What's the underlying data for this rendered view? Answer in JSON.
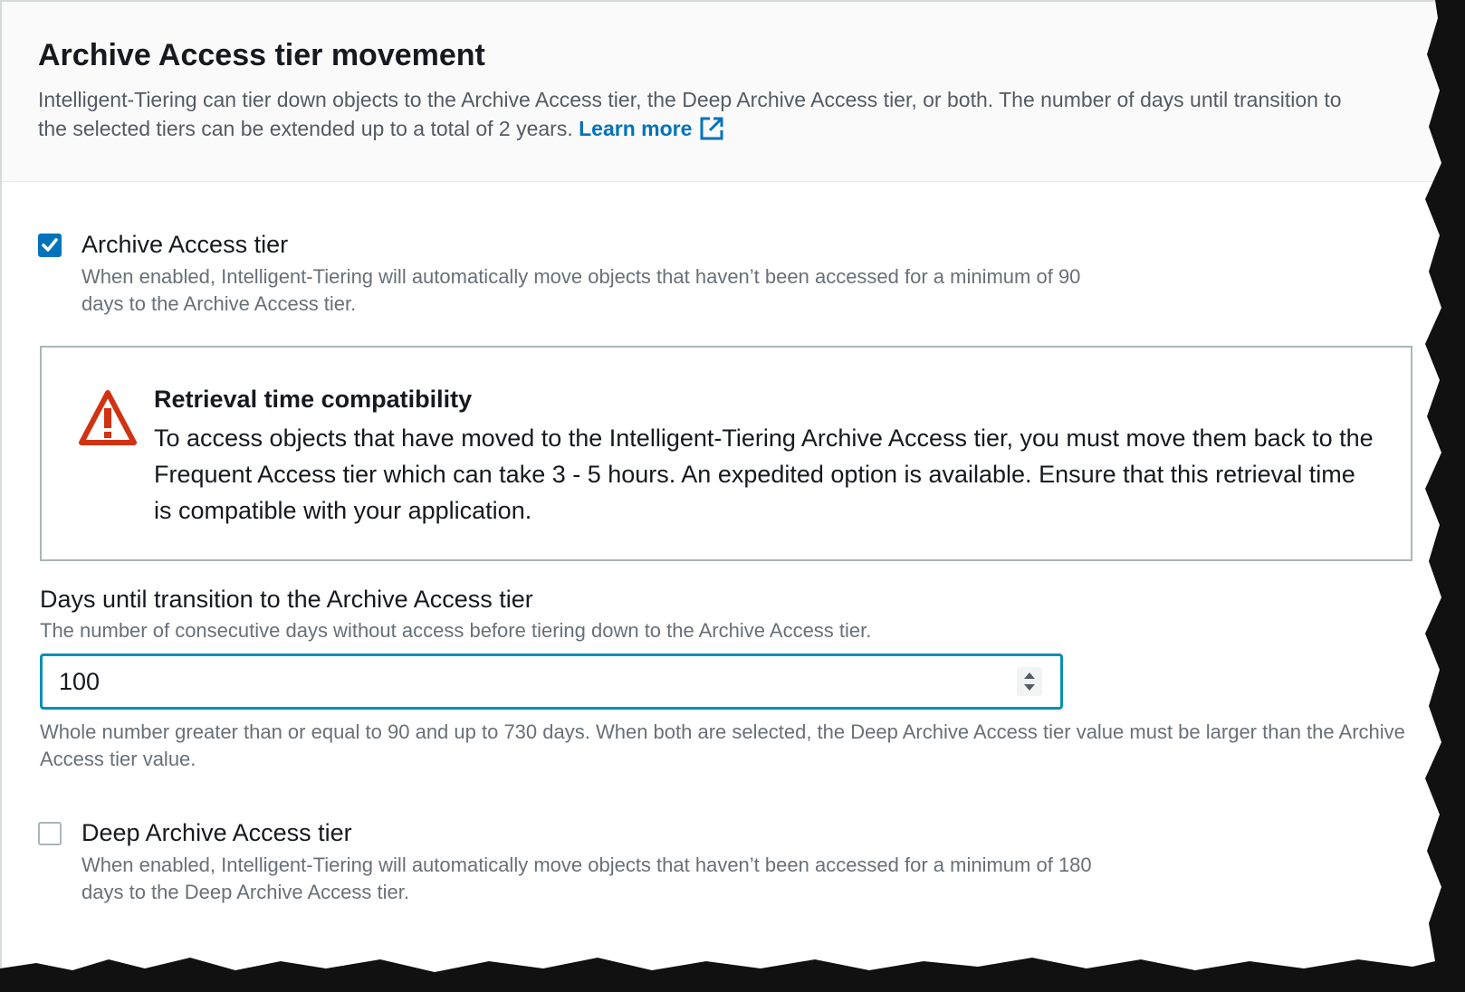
{
  "section": {
    "title": "Archive Access tier movement",
    "description": "Intelligent-Tiering can tier down objects to the Archive Access tier, the Deep Archive Access tier, or both. The number of days until transition to the selected tiers can be extended up to a total of 2 years.",
    "learn_more": "Learn more"
  },
  "archive_option": {
    "label": "Archive Access tier",
    "checked": true,
    "description": "When enabled, Intelligent-Tiering will automatically move objects that haven’t been accessed for a minimum of 90 days to the Archive Access tier."
  },
  "alert": {
    "title": "Retrieval time compatibility",
    "body": "To access objects that have moved to the Intelligent-Tiering Archive Access tier, you must move them back to the Frequent Access tier which can take 3 - 5 hours. An expedited option is available. Ensure that this retrieval time is compatible with your application."
  },
  "days_field": {
    "label": "Days until transition to the Archive Access tier",
    "description": "The number of consecutive days without access before tiering down to the Archive Access tier.",
    "value": "100",
    "hint": "Whole number greater than or equal to 90 and up to 730 days. When both are selected, the Deep Archive Access tier value must be larger than the Archive Access tier value."
  },
  "deep_archive_option": {
    "label": "Deep Archive Access tier",
    "checked": false,
    "description": "When enabled, Intelligent-Tiering will automatically move objects that haven’t been accessed for a minimum of 180 days to the Deep Archive Access tier."
  },
  "colors": {
    "accent": "#0073bb",
    "focus_border": "#0a8fb5",
    "warning": "#d13212",
    "text": "#16191f",
    "muted_text": "#687078"
  },
  "icons": {
    "external_link": "external-link-icon",
    "warning": "warning-icon",
    "checkmark": "checkmark-icon",
    "stepper": "stepper-icon"
  }
}
